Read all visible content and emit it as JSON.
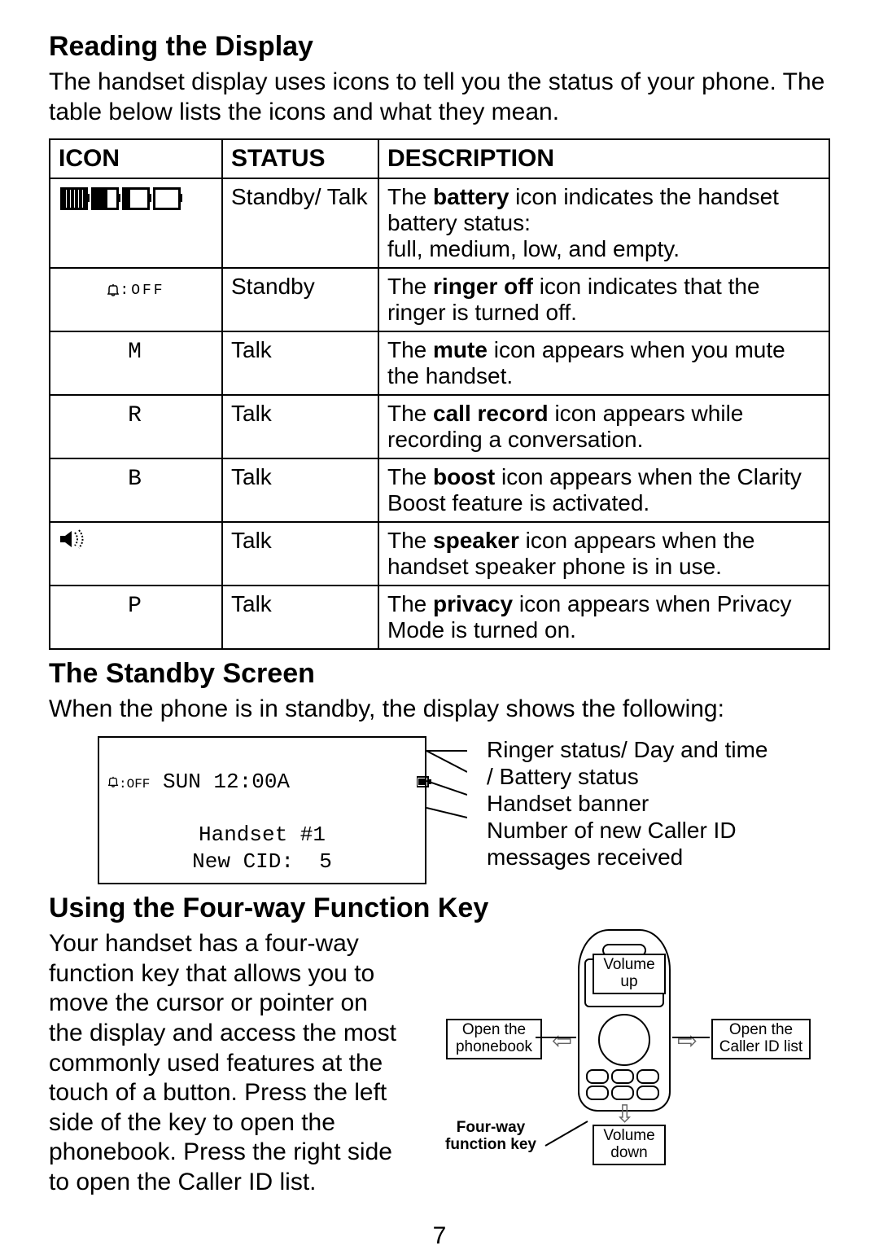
{
  "page_number": "7",
  "section1": {
    "title": "Reading the Display",
    "intro": "The handset display uses icons to tell you the status of your phone. The table below lists the icons and what they mean."
  },
  "table": {
    "headers": {
      "icon": "ICON",
      "status": "STATUS",
      "description": "DESCRIPTION"
    },
    "rows": [
      {
        "icon_name": "battery-levels-icon",
        "status": "Standby/ Talk",
        "desc_pre": "The ",
        "desc_bold": "battery",
        "desc_post": " icon indicates the handset battery status:\nfull, medium, low, and empty."
      },
      {
        "icon_name": "ringer-off-icon",
        "icon_text": "🔔:OFF",
        "status": "Standby",
        "desc_pre": "The ",
        "desc_bold": "ringer off",
        "desc_post": " icon indicates that the ringer is turned off."
      },
      {
        "icon_name": "mute-icon",
        "icon_text": "M",
        "status": "Talk",
        "desc_pre": "The ",
        "desc_bold": "mute",
        "desc_post": " icon appears when you mute the handset."
      },
      {
        "icon_name": "call-record-icon",
        "icon_text": "R",
        "status": "Talk",
        "desc_pre": "The ",
        "desc_bold": "call record",
        "desc_post": " icon appears while recording a conversation."
      },
      {
        "icon_name": "boost-icon",
        "icon_text": "B",
        "status": "Talk",
        "desc_pre": "The ",
        "desc_bold": "boost",
        "desc_post": " icon appears when the Clarity Boost feature is activated."
      },
      {
        "icon_name": "speaker-icon",
        "icon_text": "🔊",
        "status": "Talk",
        "desc_pre": "The ",
        "desc_bold": "speaker",
        "desc_post": " icon appears when the handset speaker phone is in use."
      },
      {
        "icon_name": "privacy-icon",
        "icon_text": "P",
        "status": "Talk",
        "desc_pre": "The ",
        "desc_bold": "privacy",
        "desc_post": " icon appears when Privacy Mode is turned on."
      }
    ]
  },
  "section2": {
    "title": "The Standby Screen",
    "intro": "When the phone is in standby, the display shows the following:",
    "lcd": {
      "line1_left": "🔔:OFF SUN 12:00A",
      "line1_batt": "▮",
      "line2": "Handset #1",
      "line3": "New CID:  5"
    },
    "labels": {
      "l1": "Ringer status/ Day and time",
      "l2": "/ Battery status",
      "l3": "Handset banner",
      "l4": "Number of new Caller ID",
      "l5": "messages received"
    }
  },
  "section3": {
    "title": "Using the Four-way Function Key",
    "body": "Your handset has a four-way function key that allows you to move the cursor or pointer on the display and access the most commonly used features at the touch of a button. Press the left side of the key to open the phonebook. Press the right side to open the Caller ID list.",
    "diagram": {
      "volume_up": "Volume up",
      "volume_down": "Volume down",
      "open_phonebook": "Open the phonebook",
      "open_cid": "Open the Caller ID list",
      "fwk_label": "Four-way function key"
    }
  }
}
